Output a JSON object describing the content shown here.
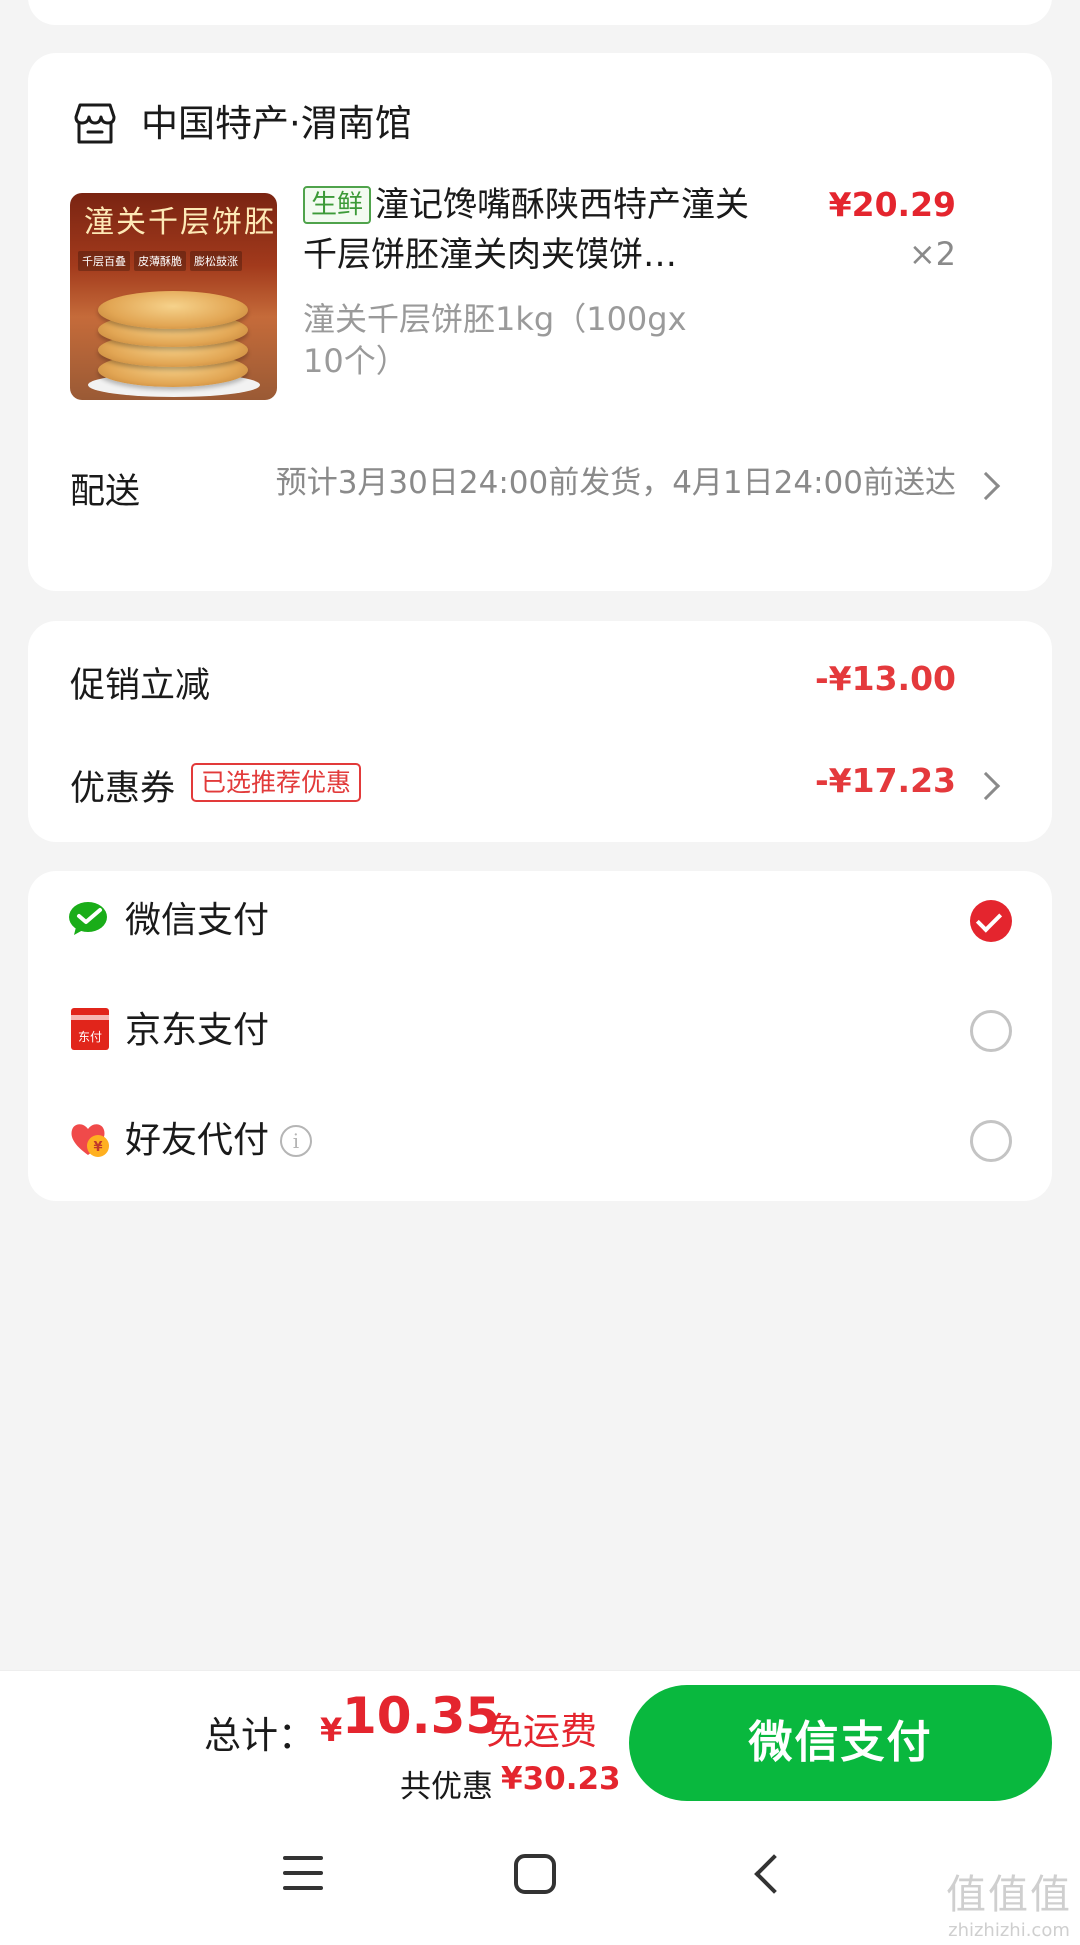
{
  "store": {
    "name": "中国特产·渭南馆"
  },
  "product": {
    "image_title": "潼关千层饼胚",
    "image_tags": [
      "千层百叠",
      "皮薄酥脆",
      "膨松鼓涨"
    ],
    "tag": "生鲜",
    "title": "潼记馋嘴酥陕西特产潼关千层饼胚潼关肉夹馍饼…",
    "price": "¥20.29",
    "quantity": "×2",
    "spec": "潼关千层饼胚1kg（100gx 10个）"
  },
  "delivery": {
    "label": "配送",
    "info": "预计3月30日24:00前发货，4月1日24:00前送达"
  },
  "discounts": {
    "promo_label": "促销立减",
    "promo_value": "-¥13.00",
    "coupon_label": "优惠券",
    "coupon_tag": "已选推荐优惠",
    "coupon_value": "-¥17.23"
  },
  "payment_methods": [
    {
      "label": "微信支付",
      "icon": "wechat-pay-icon",
      "selected": true
    },
    {
      "label": "京东支付",
      "icon": "jd-pay-icon",
      "icon_text": "东付",
      "selected": false
    },
    {
      "label": "好友代付",
      "icon": "friend-pay-icon",
      "icon_text": "¥",
      "selected": false
    }
  ],
  "summary": {
    "total_label": "总计：",
    "currency": "¥",
    "total_amount": "10.35",
    "free_shipping": "免运费",
    "saved_label": "共优惠",
    "saved_value": "¥30.23",
    "pay_button": "微信支付"
  },
  "watermark": {
    "logo": "值值值",
    "site": "zhizhizhi.com"
  },
  "colors": {
    "accent_red": "#e4252e",
    "wechat_green": "#09b83e",
    "fresh_green": "#4fa34b"
  }
}
